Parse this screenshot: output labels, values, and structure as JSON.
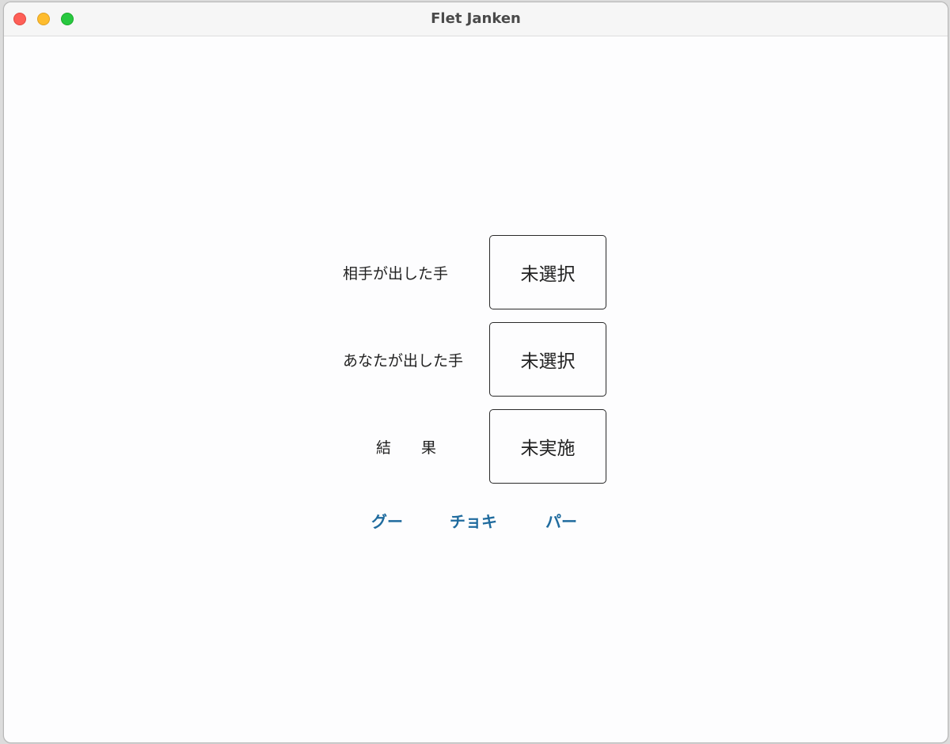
{
  "window": {
    "title": "Flet Janken"
  },
  "rows": {
    "opponent": {
      "label": "相手が出した手",
      "value": "未選択"
    },
    "player": {
      "label": "あなたが出した手",
      "value": "未選択"
    },
    "result": {
      "label": "結　　果",
      "value": "未実施"
    }
  },
  "buttons": {
    "rock": "グー",
    "scissors": "チョキ",
    "paper": "パー"
  },
  "colors": {
    "button_text": "#1f6b9e",
    "close": "#fe5f57",
    "minimize": "#febc2e",
    "zoom": "#28c840"
  }
}
